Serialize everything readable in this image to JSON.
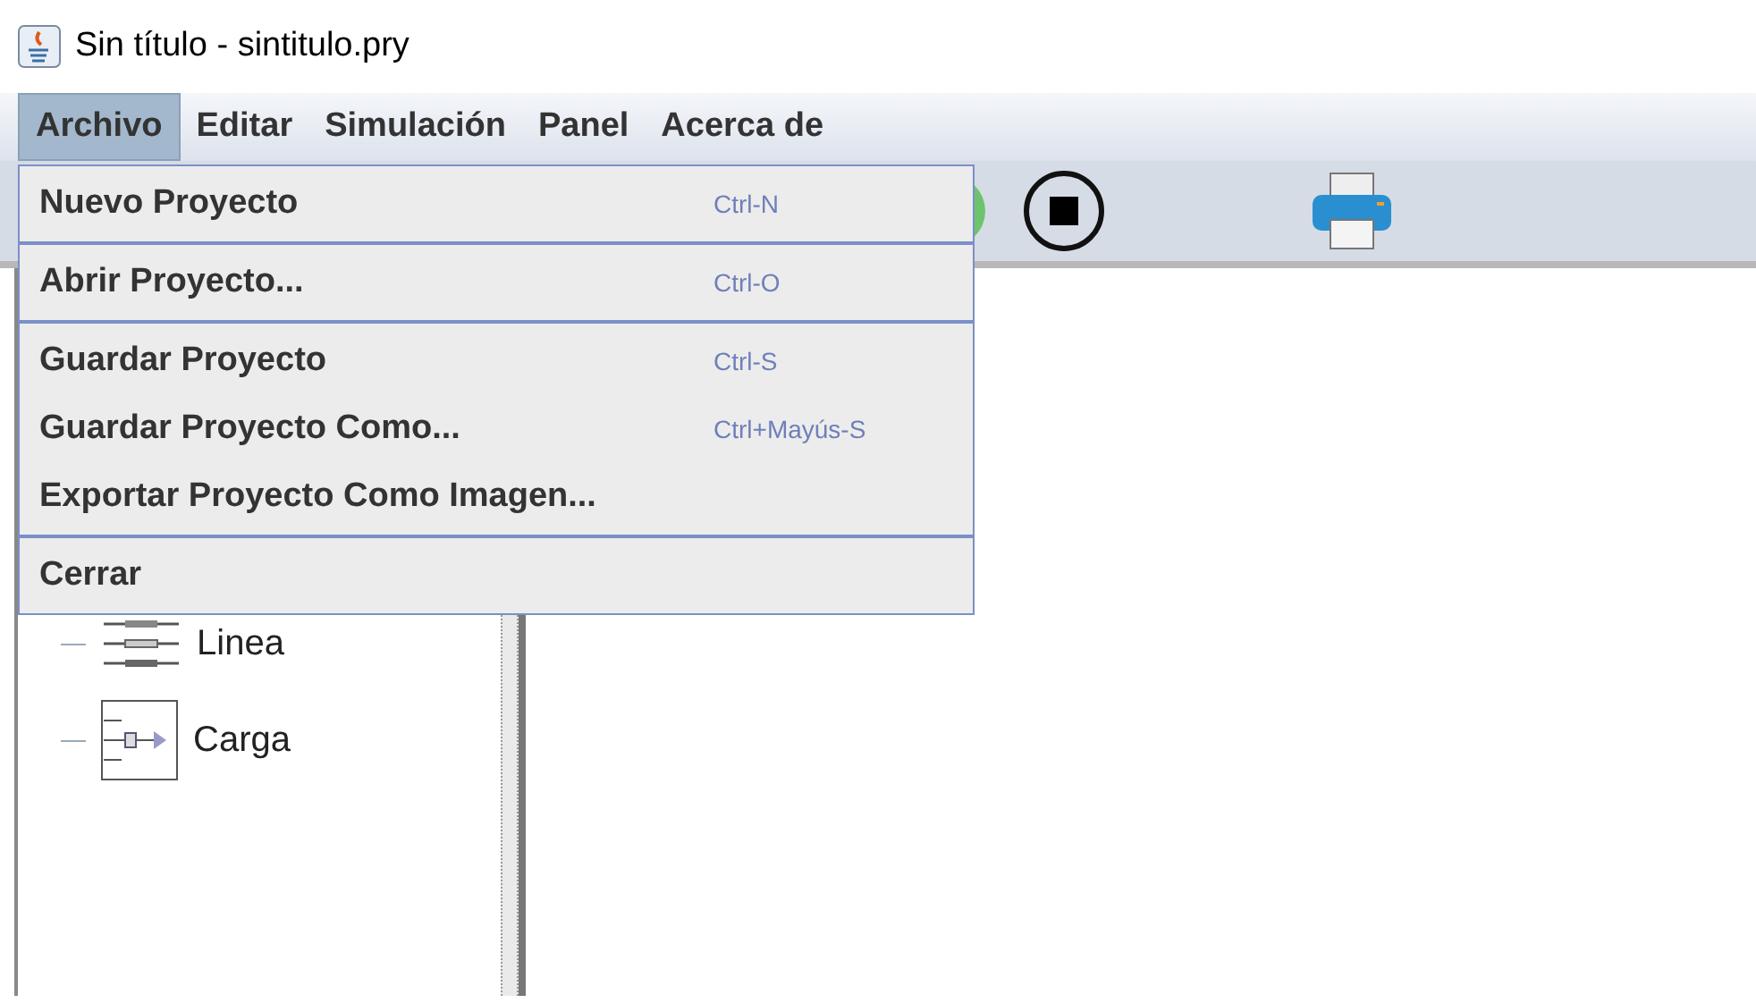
{
  "window": {
    "title": "Sin título - sintitulo.pry"
  },
  "menubar": [
    {
      "label": "Archivo",
      "selected": true
    },
    {
      "label": "Editar",
      "selected": false
    },
    {
      "label": "Simulación",
      "selected": false
    },
    {
      "label": "Panel",
      "selected": false
    },
    {
      "label": "Acerca de",
      "selected": false
    }
  ],
  "menu_groups": [
    [
      {
        "label": "Nuevo Proyecto",
        "shortcut": "Ctrl-N"
      }
    ],
    [
      {
        "label": "Abrir Proyecto...",
        "shortcut": "Ctrl-O"
      }
    ],
    [
      {
        "label": "Guardar Proyecto",
        "shortcut": "Ctrl-S"
      },
      {
        "label": "Guardar Proyecto Como...",
        "shortcut": "Ctrl+Mayús-S"
      },
      {
        "label": "Exportar Proyecto Como Imagen..."
      }
    ],
    [
      {
        "label": "Cerrar"
      }
    ]
  ],
  "tree": [
    {
      "label": "Linea",
      "kind": "line"
    },
    {
      "label": "Carga",
      "kind": "load"
    }
  ]
}
